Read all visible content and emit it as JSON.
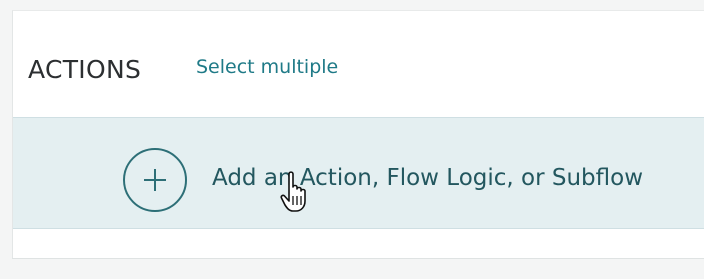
{
  "actions_panel": {
    "title": "ACTIONS",
    "select_multiple_label": "Select multiple",
    "add_action_label": "Add an Action, Flow Logic, or Subflow"
  },
  "icons": {
    "add": "plus-circle-icon",
    "cursor": "hand-pointer-cursor-icon"
  },
  "colors": {
    "accent": "#1f7a87",
    "add_row_background": "#e4eff1",
    "add_text": "#23575f"
  }
}
